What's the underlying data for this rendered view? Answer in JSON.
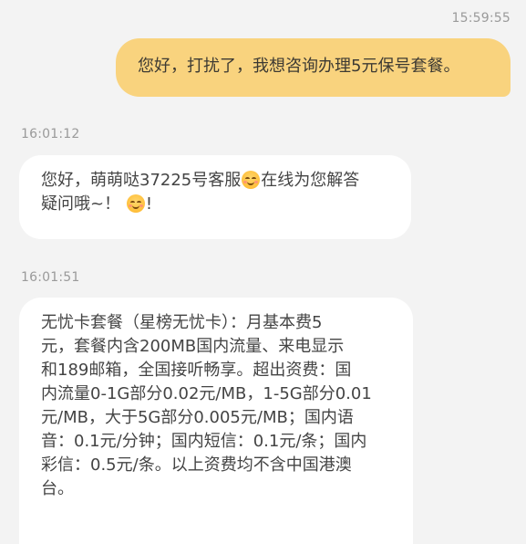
{
  "messages": {
    "outgoing_1": {
      "time": "15:59:55",
      "text": "您好，打扰了，我想咨询办理5元保号套餐。"
    },
    "incoming_1": {
      "time": "16:01:12",
      "line1_a": "您好，萌萌哒37225号客服",
      "line1_emoji": "smiling-face-with-blush-icon",
      "line1_b": "在线为您解答",
      "line2_a": "疑问哦~！",
      "line2_emoji": "smiling-face-with-blush-icon",
      "line2_b": "!"
    },
    "incoming_2": {
      "time": "16:01:51",
      "lines": [
        "无忧卡套餐（星榜无忧卡）：月基本费5",
        "元，套餐内含200MB国内流量、来电显示",
        "和189邮箱，全国接听畅享。超出资费：国",
        "内流量0-1G部分0.02元/MB，1-5G部分0.01",
        "元/MB，大于5G部分0.005元/MB；国内语",
        "音：0.1元/分钟；国内短信：0.1元/条；国内",
        "彩信：0.5元/条。以上资费均不含中国港澳",
        "台。"
      ]
    }
  },
  "colors": {
    "background": "#f3f3f3",
    "outgoing_bubble": "#f9d37e",
    "incoming_bubble": "#ffffff",
    "timestamp": "#9a9a9a"
  }
}
